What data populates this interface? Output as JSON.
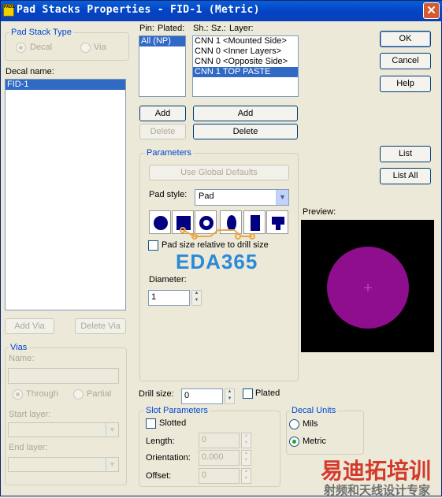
{
  "window": {
    "title": "Pad Stacks Properties - FID-1 (Metric)",
    "close_label": "✕",
    "icon_text": "PADS"
  },
  "pad_stack_type": {
    "label": "Pad Stack Type",
    "decal": "Decal",
    "via": "Via",
    "selected": "Decal"
  },
  "decal_name": {
    "label": "Decal name:",
    "items": [
      "FID-1"
    ]
  },
  "pin_list": {
    "header_pin": "Pin:",
    "header_plated": "Plated:",
    "items": [
      "All (NP)"
    ]
  },
  "layer_list": {
    "header_sh": "Sh.:",
    "header_sz": "Sz.:",
    "header_layer": "Layer:",
    "items": [
      "CNN 1 <Mounted Side>",
      "CNN 0 <Inner Layers>",
      "CNN 0 <Opposite Side>",
      "CNN 1 TOP PASTE"
    ],
    "selected_index": 3
  },
  "buttons": {
    "ok": "OK",
    "cancel": "Cancel",
    "help": "Help",
    "list": "List",
    "list_all": "List All",
    "add_pin": "Add",
    "delete_pin": "Delete",
    "add_layer": "Add",
    "delete_layer": "Delete",
    "add_via": "Add Via",
    "delete_via": "Delete Via",
    "use_global_defaults": "Use Global Defaults"
  },
  "parameters": {
    "label": "Parameters",
    "pad_style_label": "Pad style:",
    "pad_style_value": "Pad",
    "relative_label": "Pad size relative to drill size",
    "relative_checked": false,
    "diameter_label": "Diameter:",
    "diameter_value": "1",
    "shapes": [
      "round-pad-icon",
      "square-pad-icon",
      "annular-pad-icon",
      "oval-pad-icon",
      "rectangle-pad-icon",
      "thermal-pad-icon"
    ]
  },
  "preview": {
    "label": "Preview:",
    "pad_color": "#8e0e8e",
    "crosshair_color": "#d050d0"
  },
  "vias": {
    "label": "Vias",
    "name_label": "Name:",
    "name_value": "",
    "through": "Through",
    "partial": "Partial",
    "start_layer_label": "Start layer:",
    "end_layer_label": "End layer:"
  },
  "drill": {
    "label": "Drill size:",
    "value": "0",
    "plated_label": "Plated",
    "plated_checked": false
  },
  "slot_parameters": {
    "label": "Slot Parameters",
    "slotted_label": "Slotted",
    "slotted_checked": false,
    "length_label": "Length:",
    "length_value": "0",
    "orientation_label": "Orientation:",
    "orientation_value": "0.000",
    "offset_label": "Offset:",
    "offset_value": "0"
  },
  "decal_units": {
    "label": "Decal Units",
    "mils": "Mils",
    "metric": "Metric",
    "selected": "Metric"
  },
  "watermark": {
    "eda_text": "EDA365",
    "cn_title": "易迪拓培训",
    "cn_subtitle": "射频和天线设计专家"
  }
}
